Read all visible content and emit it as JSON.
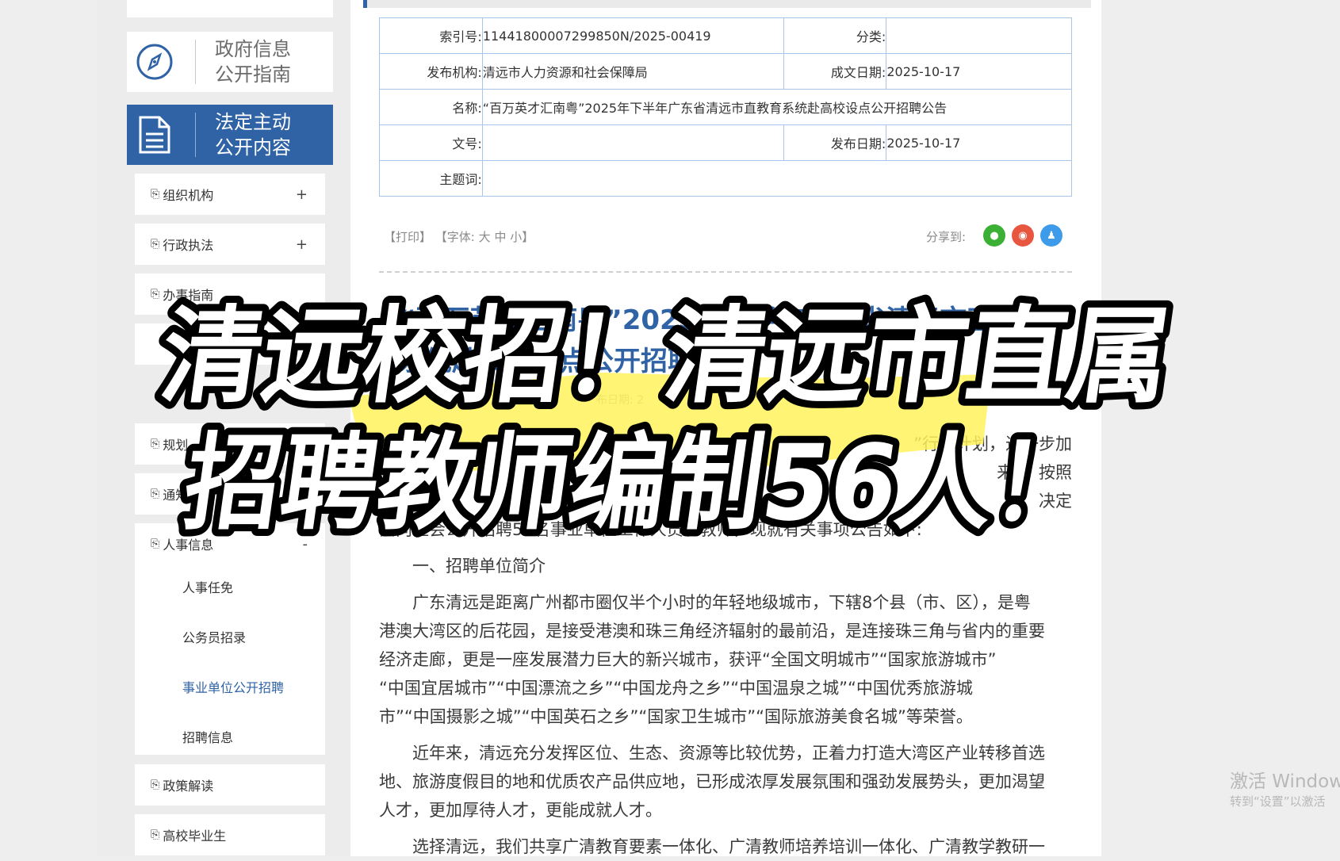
{
  "sidebar": {
    "nav_guide": "政府信息公开指南",
    "nav_guide_l1": "政府信息",
    "nav_guide_l2": "公开指南",
    "nav_active_l1": "法定主动",
    "nav_active_l2": "公开内容",
    "items": [
      {
        "label": "组织机构",
        "toggle": "+"
      },
      {
        "label": "行政执法",
        "toggle": "+"
      },
      {
        "label": "办事指南"
      },
      {
        "label": "规划"
      },
      {
        "label": "通知"
      },
      {
        "label": "人事信息",
        "toggle": "-"
      }
    ],
    "sub_items": [
      "人事任免",
      "公务员招录",
      "事业单位公开招聘",
      "招聘信息"
    ],
    "bottom_items": [
      {
        "label": "政策解读"
      },
      {
        "label": "高校毕业生"
      }
    ]
  },
  "meta": {
    "index_label": "索引号:",
    "index_value": "11441800007299850N/2025-00419",
    "category_label": "分类:",
    "category_value": "",
    "org_label": "发布机构:",
    "org_value": "清远市人力资源和社会保障局",
    "created_label": "成文日期:",
    "created_value": "2025-10-17",
    "name_label": "名称:",
    "name_value": "“百万英才汇南粤”2025年下半年广东省清远市直教育系统赴高校设点公开招聘公告",
    "doc_no_label": "文号:",
    "doc_no_value": "",
    "published_label": "发布日期:",
    "published_value": "2025-10-17",
    "subject_label": "主题词:",
    "subject_value": ""
  },
  "toolbar": {
    "print": "【打印】",
    "font": "【字体:",
    "font_large": "大",
    "font_medium": "中",
    "font_small": "小】",
    "share_label": "分享到:"
  },
  "share_icons": [
    "wechat-icon",
    "weibo-icon",
    "qq-icon"
  ],
  "article": {
    "title_partial": "“百万英才汇南粤”2025年下半年广东省清远市直教育系统赴高校设点公开招聘公告",
    "date_partial": "布日期: 2",
    "intro_partial_right": "”行动计划，进一步加",
    "intro_partial_right2": "来”，按照",
    "intro_partial_right3": "决定",
    "intro_line": "面向社会公开招聘56名事业单位工作人员和教师，现就有关事项公告如下:",
    "section1": "一、招聘单位简介",
    "p1_l1": "广东清远是距离广州都市圈仅半个小时的年轻地级城市，下辖8个县（市、区），是粤",
    "p1_l2": "港澳大湾区的后花园，是接受港澳和珠三角经济辐射的最前沿，是连接珠三角与省内的重要",
    "p1_l3": "经济走廊，更是一座发展潜力巨大的新兴城市，获评“全国文明城市”“国家旅游城市”",
    "p1_l4": "“中国宜居城市”“中国漂流之乡”“中国龙舟之乡”“中国温泉之城”“中国优秀旅游城",
    "p1_l5": "市”“中国摄影之城”“中国英石之乡”“国家卫生城市”“国际旅游美食名城”等荣誉。",
    "p2_l1": "近年来，清远充分发挥区位、生态、资源等比较优势，正着力打造大湾区产业转移首选",
    "p2_l2": "地、旅游度假目的地和优质农产品供应地，已形成浓厚发展氛围和强劲发展势头，更加渴望",
    "p2_l3": "人才，更加厚待人才，更能成就人才。",
    "p3_l1": "选择清远，我们共享广清教育要素一体化、广清教师培养培训一体化、广清教学教研一"
  },
  "overlay": {
    "line1": "清远校招！清远市直属",
    "line2": "招聘教师编制56人！",
    "highlight_color": "#fff25a"
  },
  "watermark": {
    "line1": "激活 Window",
    "line2": "转到“设置”以激活"
  },
  "colors": {
    "accent": "#2f63a6",
    "table_border": "#a8c6ea",
    "wechat": "#3cb035",
    "weibo": "#e8563f",
    "qq": "#3d9be9"
  }
}
